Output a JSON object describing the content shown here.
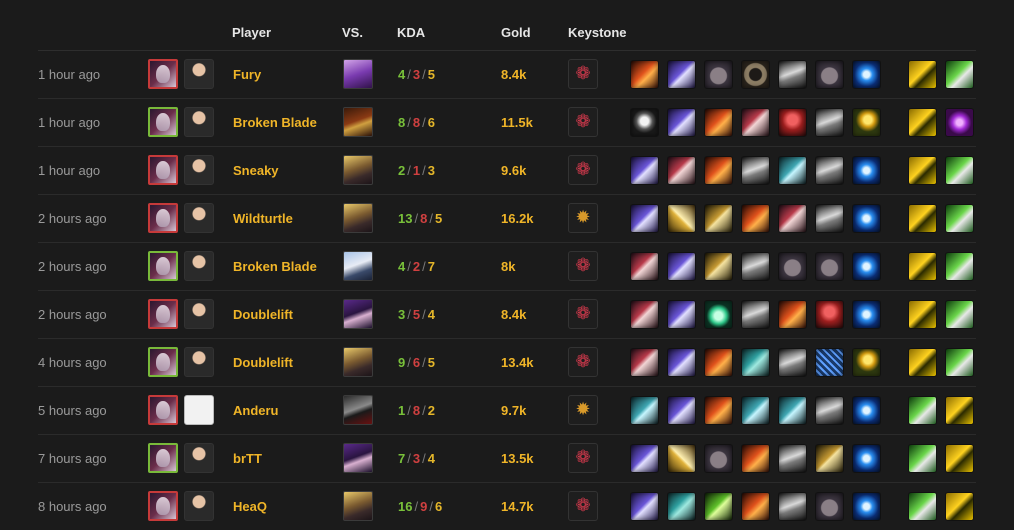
{
  "header": {
    "player": "Player",
    "vs": "VS.",
    "kda": "KDA",
    "gold": "Gold",
    "keystone": "Keystone"
  },
  "colors": {
    "kills": "#79c13a",
    "deaths": "#d04040",
    "assists": "#e4b62a",
    "gold": "#f0b528",
    "loss_border": "#c63a3a",
    "win_border": "#79b93a"
  },
  "rows": [
    {
      "time": "1 hour ago",
      "player": "Fury",
      "result": "loss",
      "avatar": "player-photo",
      "vs_icon": "purple-champion-icon",
      "k": "4",
      "d": "3",
      "a": "5",
      "gold": "8.4k",
      "keystone": "pink-swirl-keystone-icon",
      "items": [
        "fire-blade-icon",
        "purple-sword-icon",
        "gray-pouch-icon",
        "round-shield-icon",
        "armor-boots-icon",
        "gray-pouch-icon",
        "blue-orb-icon"
      ],
      "trinkets": [
        "yellow-ward-icon",
        "green-ward-icon"
      ]
    },
    {
      "time": "1 hour ago",
      "player": "Broken Blade",
      "result": "win",
      "avatar": "player-photo",
      "vs_icon": "lizard-champion-icon",
      "k": "8",
      "d": "8",
      "a": "6",
      "gold": "11.5k",
      "keystone": "pink-swirl-keystone-icon",
      "items": [
        "gray-armor-icon",
        "purple-sword-icon",
        "fire-blade-icon",
        "red-dagger-icon",
        "red-hat-icon",
        "armor-boots-icon",
        "golden-flower-icon"
      ],
      "trinkets": [
        "yellow-ward-icon",
        "purple-lens-icon"
      ]
    },
    {
      "time": "1 hour ago",
      "player": "Sneaky",
      "result": "loss",
      "avatar": "player-photo",
      "vs_icon": "blonde-champion-icon",
      "k": "2",
      "d": "1",
      "a": "3",
      "gold": "9.6k",
      "keystone": "pink-swirl-keystone-icon",
      "items": [
        "purple-sword-icon",
        "red-dagger-icon",
        "fire-blade-icon",
        "armor-boots-icon",
        "cyan-blade-icon",
        "armor-boots-icon",
        "blue-orb-icon"
      ],
      "trinkets": [
        "yellow-ward-icon",
        "green-ward-icon"
      ]
    },
    {
      "time": "2 hours ago",
      "player": "Wildturtle",
      "result": "loss",
      "avatar": "player-photo",
      "vs_icon": "blonde-champion-icon",
      "k": "13",
      "d": "8",
      "a": "5",
      "gold": "16.2k",
      "keystone": "golden-sun-keystone-icon",
      "items": [
        "purple-sword-icon",
        "crossed-blades-icon",
        "golden-bow-icon",
        "fire-blade-icon",
        "red-dagger-icon",
        "armor-boots-icon",
        "blue-orb-icon"
      ],
      "trinkets": [
        "yellow-ward-icon",
        "green-ward-icon"
      ]
    },
    {
      "time": "2 hours ago",
      "player": "Broken Blade",
      "result": "win",
      "avatar": "player-photo",
      "vs_icon": "ghost-champion-icon",
      "k": "4",
      "d": "2",
      "a": "7",
      "gold": "8k",
      "keystone": "pink-swirl-keystone-icon",
      "items": [
        "red-dagger-icon",
        "purple-sword-icon",
        "golden-bow-icon",
        "armor-boots-icon",
        "gray-pouch-icon",
        "gray-pouch-icon",
        "blue-orb-icon"
      ],
      "trinkets": [
        "yellow-ward-icon",
        "green-ward-icon"
      ]
    },
    {
      "time": "2 hours ago",
      "player": "Doublelift",
      "result": "loss",
      "avatar": "player-photo",
      "vs_icon": "purple-hair-champion-icon",
      "k": "3",
      "d": "5",
      "a": "4",
      "gold": "8.4k",
      "keystone": "pink-swirl-keystone-icon",
      "items": [
        "red-dagger-icon",
        "purple-sword-icon",
        "green-potion-icon",
        "armor-boots-icon",
        "fire-blade-icon",
        "red-hat-icon",
        "blue-orb-icon"
      ],
      "trinkets": [
        "yellow-ward-icon",
        "green-ward-icon"
      ]
    },
    {
      "time": "4 hours ago",
      "player": "Doublelift",
      "result": "win",
      "avatar": "player-photo",
      "vs_icon": "blonde-champion-icon",
      "k": "9",
      "d": "6",
      "a": "5",
      "gold": "13.4k",
      "keystone": "pink-swirl-keystone-icon",
      "items": [
        "red-dagger-icon",
        "purple-sword-icon",
        "fire-blade-icon",
        "cyan-crystal-icon",
        "armor-boots-icon",
        "blue-mesh-icon",
        "golden-flower-icon"
      ],
      "trinkets": [
        "yellow-ward-icon",
        "green-ward-icon"
      ]
    },
    {
      "time": "5 hours ago",
      "player": "Anderu",
      "result": "loss",
      "avatar": "blank-photo",
      "vs_icon": "dark-champion-icon",
      "k": "1",
      "d": "8",
      "a": "2",
      "gold": "9.7k",
      "keystone": "golden-sun-keystone-icon",
      "items": [
        "cyan-blade-icon",
        "purple-sword-icon",
        "fire-blade-icon",
        "cyan-blade-icon",
        "cyan-blade-icon",
        "armor-boots-icon",
        "blue-orb-icon"
      ],
      "trinkets": [
        "green-ward-icon",
        "yellow-ward-icon"
      ]
    },
    {
      "time": "7 hours ago",
      "player": "brTT",
      "result": "win",
      "avatar": "player-photo",
      "vs_icon": "purple-hair-champion-icon",
      "k": "7",
      "d": "3",
      "a": "4",
      "gold": "13.5k",
      "keystone": "pink-swirl-keystone-icon",
      "items": [
        "purple-sword-icon",
        "crossed-blades-icon",
        "gray-pouch-icon",
        "fire-blade-icon",
        "armor-boots-icon",
        "golden-bow-icon",
        "blue-orb-icon"
      ],
      "trinkets": [
        "green-ward-icon",
        "yellow-ward-icon"
      ]
    },
    {
      "time": "8 hours ago",
      "player": "HeaQ",
      "result": "loss",
      "avatar": "player-photo",
      "vs_icon": "blonde-champion-icon",
      "k": "16",
      "d": "9",
      "a": "6",
      "gold": "14.7k",
      "keystone": "pink-swirl-keystone-icon",
      "items": [
        "purple-sword-icon",
        "cyan-crystal-icon",
        "green-bow-icon",
        "fire-blade-icon",
        "armor-boots-icon",
        "gray-pouch-icon",
        "blue-orb-icon"
      ],
      "trinkets": [
        "green-ward-icon",
        "yellow-ward-icon"
      ]
    }
  ]
}
